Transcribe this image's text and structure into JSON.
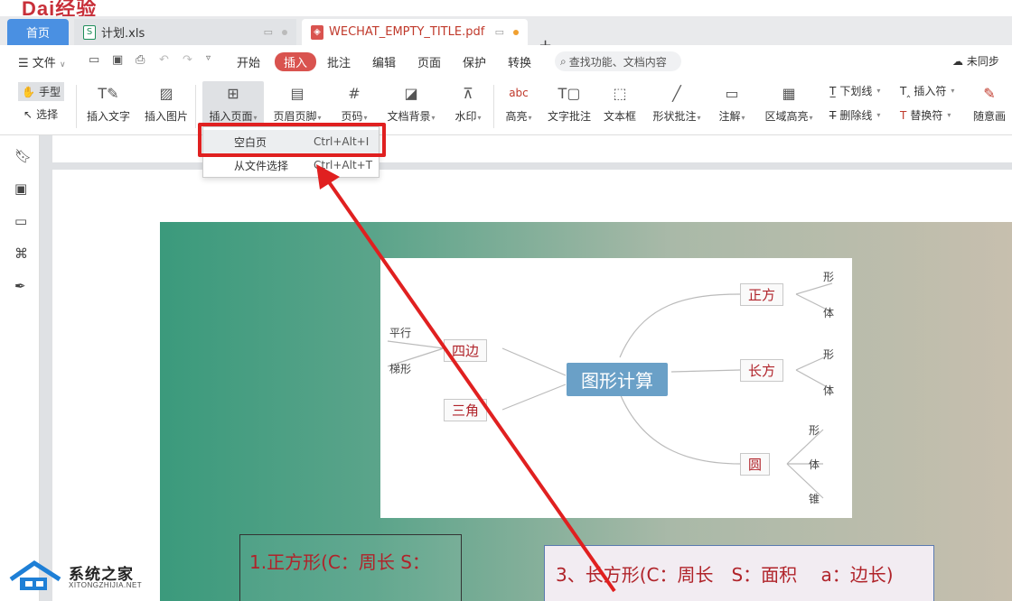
{
  "tabs": {
    "home": "首页",
    "xls": "计划.xls",
    "pdf": "WECHAT_EMPTY_TITLE.pdf",
    "new": "+"
  },
  "menu": {
    "file": "文件",
    "items": [
      "开始",
      "插入",
      "批注",
      "编辑",
      "页面",
      "保护",
      "转换"
    ],
    "search_placeholder": "查找功能、文档内容",
    "sync": "未同步"
  },
  "ribbon": {
    "hand": "手型",
    "select": "选择",
    "insert_text": "插入文字",
    "insert_image": "插入图片",
    "insert_page": "插入页面",
    "header_footer": "页眉页脚",
    "page_number": "页码",
    "doc_bg": "文档背景",
    "watermark": "水印",
    "highlight": "高亮",
    "text_note": "文字批注",
    "textbox": "文本框",
    "shape_note": "形状批注",
    "annotation": "注解",
    "area_highlight": "区域高亮",
    "underline": "下划线",
    "strikethrough": "删除线",
    "insert_symbol": "插入符",
    "replace_symbol": "替换符",
    "freehand": "随意画"
  },
  "dropdown": {
    "blank_page": "空白页",
    "blank_page_key": "Ctrl+Alt+I",
    "from_file": "从文件选择",
    "from_file_key": "Ctrl+Alt+T"
  },
  "mindmap": {
    "center": "图形计算",
    "square": "正方",
    "rect": "长方",
    "circle": "圆",
    "quad": "四边",
    "tri": "三角",
    "parallel": "平行",
    "trapezoid": "梯形",
    "leaf_shape": "形",
    "leaf_body": "体",
    "leaf_cone": "锥"
  },
  "boxes": {
    "box1": "1.正方形(C：周长 S：",
    "box2": "3、长方形(C：周长　S：面积　 a：边长)"
  },
  "watermark": {
    "name": "系统之家",
    "url": "XITONGZHIJIA.NET"
  },
  "colors": {
    "accent": "#d9534f",
    "highlight_box": "#e02020",
    "tab_home": "#4a90e2"
  }
}
